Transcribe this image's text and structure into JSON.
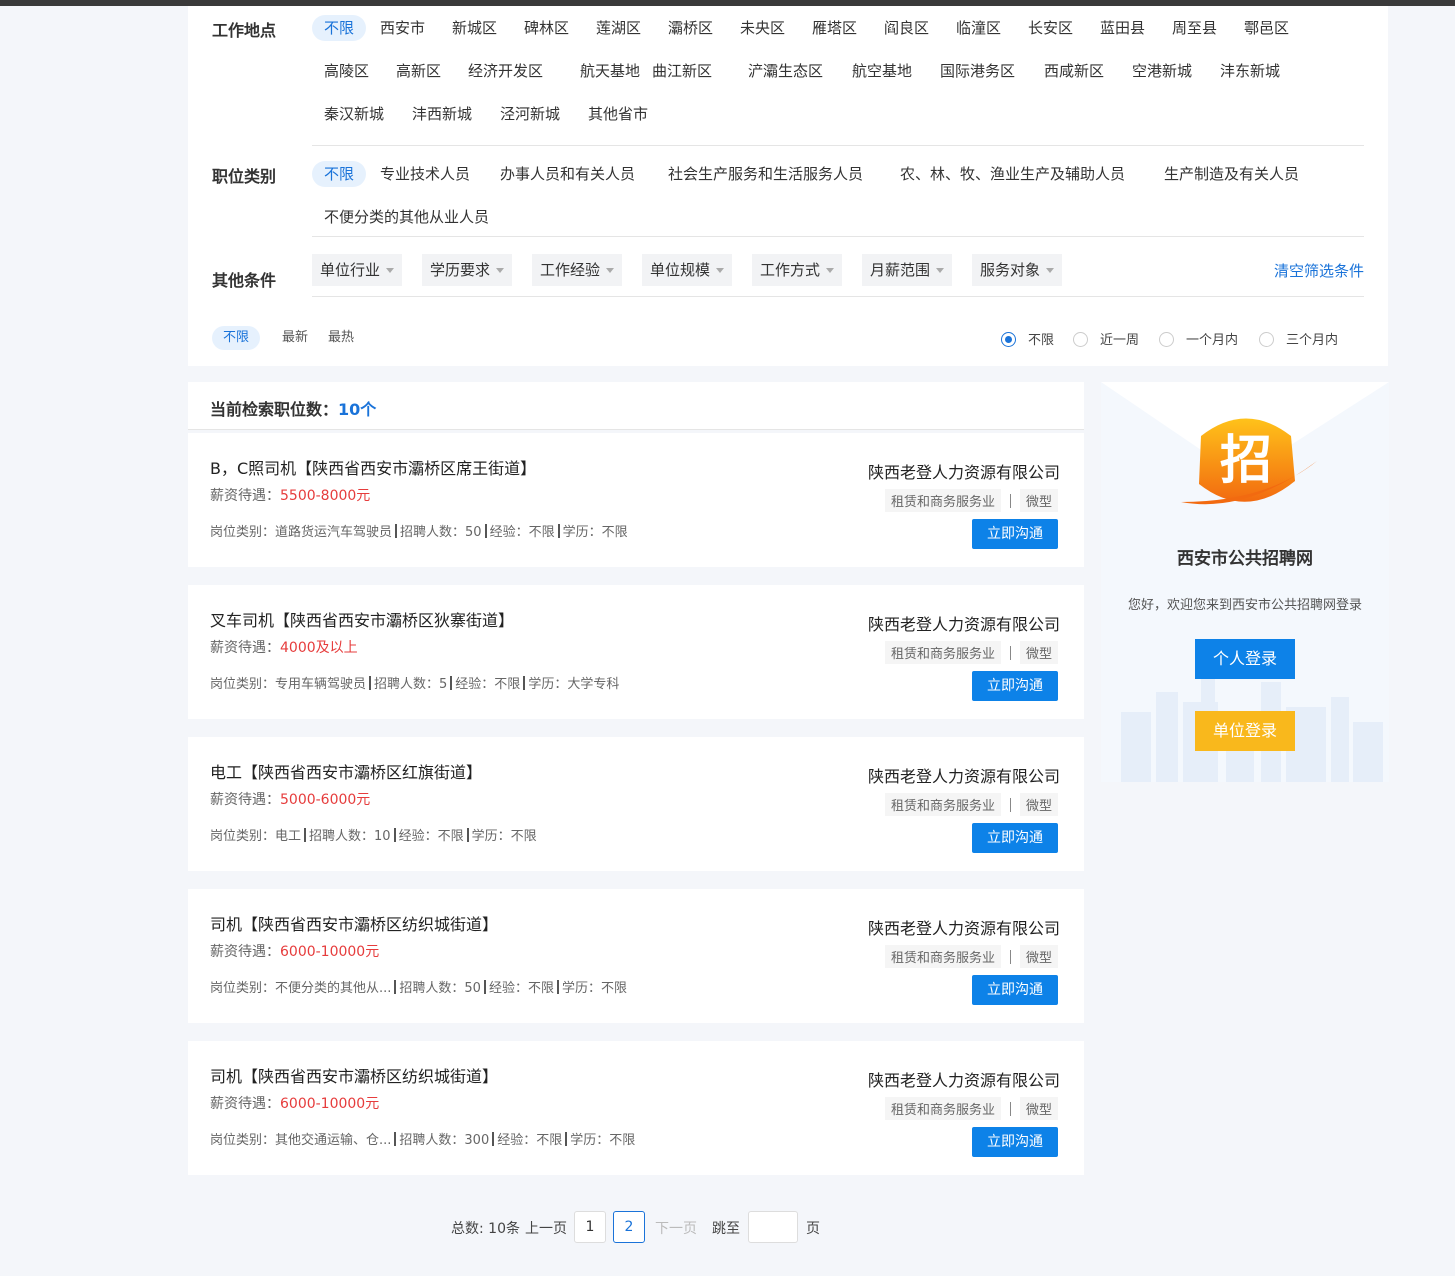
{
  "filters": {
    "location": {
      "label": "工作地点",
      "options": [
        "不限",
        "西安市",
        "新城区",
        "碑林区",
        "莲湖区",
        "灞桥区",
        "未央区",
        "雁塔区",
        "阎良区",
        "临潼区",
        "长安区",
        "蓝田县",
        "周至县",
        "鄠邑区",
        "高陵区",
        "高新区",
        "经济开发区",
        "航天基地",
        "曲江新区",
        "浐灞生态区",
        "航空基地",
        "国际港务区",
        "西咸新区",
        "空港新城",
        "沣东新城",
        "秦汉新城",
        "沣西新城",
        "泾河新城",
        "其他省市"
      ]
    },
    "category": {
      "label": "职位类别",
      "options": [
        "不限",
        "专业技术人员",
        "办事人员和有关人员",
        "社会生产服务和生活服务人员",
        "农、林、牧、渔业生产及辅助人员",
        "生产制造及有关人员",
        "不便分类的其他从业人员"
      ]
    },
    "other": {
      "label": "其他条件",
      "dropdowns": [
        "单位行业",
        "学历要求",
        "工作经验",
        "单位规模",
        "工作方式",
        "月薪范围",
        "服务对象"
      ],
      "clear_label": "清空筛选条件"
    },
    "sort": {
      "tabs": [
        "不限",
        "最新",
        "最热"
      ]
    },
    "time": {
      "options": [
        "不限",
        "近一周",
        "一个月内",
        "三个月内"
      ],
      "selected": "不限"
    }
  },
  "results": {
    "count_label": "当前检索职位数：",
    "count_value": "10个",
    "salary_label": "薪资待遇：",
    "talk_label": "立即沟通",
    "jobs": [
      {
        "title": "B，C照司机【陕西省西安市灞桥区席王街道】",
        "salary": "5500-8000元",
        "meta": [
          "岗位类别：道路货运汽车驾驶员",
          "招聘人数：50",
          "经验：不限",
          "学历：不限"
        ],
        "company": "陕西老登人力资源有限公司",
        "industry": "租赁和商务服务业",
        "size": "微型"
      },
      {
        "title": "叉车司机【陕西省西安市灞桥区狄寨街道】",
        "salary": "4000及以上",
        "meta": [
          "岗位类别：专用车辆驾驶员",
          "招聘人数：5",
          "经验：不限",
          "学历：大学专科"
        ],
        "company": "陕西老登人力资源有限公司",
        "industry": "租赁和商务服务业",
        "size": "微型"
      },
      {
        "title": "电工【陕西省西安市灞桥区红旗街道】",
        "salary": "5000-6000元",
        "meta": [
          "岗位类别：电工",
          "招聘人数：10",
          "经验：不限",
          "学历：不限"
        ],
        "company": "陕西老登人力资源有限公司",
        "industry": "租赁和商务服务业",
        "size": "微型"
      },
      {
        "title": "司机【陕西省西安市灞桥区纺织城街道】",
        "salary": "6000-10000元",
        "meta": [
          "岗位类别：不便分类的其他从...",
          "招聘人数：50",
          "经验：不限",
          "学历：不限"
        ],
        "company": "陕西老登人力资源有限公司",
        "industry": "租赁和商务服务业",
        "size": "微型"
      },
      {
        "title": "司机【陕西省西安市灞桥区纺织城街道】",
        "salary": "6000-10000元",
        "meta": [
          "岗位类别：其他交通运输、仓...",
          "招聘人数：300",
          "经验：不限",
          "学历：不限"
        ],
        "company": "陕西老登人力资源有限公司",
        "industry": "租赁和商务服务业",
        "size": "微型"
      }
    ]
  },
  "sidebar": {
    "logo_icon": "zhao-recruit-logo-icon",
    "site_name": "西安市公共招聘网",
    "welcome": "您好，欢迎您来到西安市公共招聘网登录",
    "personal_login": "个人登录",
    "unit_login": "单位登录",
    "colors": {
      "primary": "#0d82e8",
      "accent": "#f9b81c"
    }
  },
  "pagination": {
    "total": "总数: 10条",
    "prev": "上一页",
    "pages": [
      "1",
      "2"
    ],
    "current": "2",
    "next": "下一页",
    "jump_to": "跳至",
    "page_unit": "页"
  }
}
